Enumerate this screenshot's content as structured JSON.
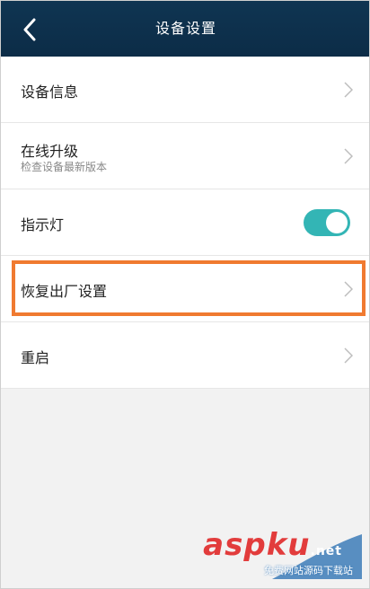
{
  "header": {
    "title": "设备设置",
    "back_icon": "chevron-left-icon"
  },
  "items": [
    {
      "label": "设备信息",
      "subtitle": "",
      "control": "chevron"
    },
    {
      "label": "在线升级",
      "subtitle": "检查设备最新版本",
      "control": "chevron"
    },
    {
      "label": "指示灯",
      "subtitle": "",
      "control": "toggle",
      "toggle_on": true
    },
    {
      "label": "恢复出厂设置",
      "subtitle": "",
      "control": "chevron",
      "highlighted": true
    },
    {
      "label": "重启",
      "subtitle": "",
      "control": "chevron"
    }
  ],
  "watermark": {
    "brand": "aspku",
    "suffix": ".net",
    "tagline": "免费网站源码下载站"
  },
  "colors": {
    "header_bg": "#0f3552",
    "toggle_on": "#33b5b5",
    "highlight_border": "#f07a30",
    "watermark_red": "#e23c3c"
  }
}
